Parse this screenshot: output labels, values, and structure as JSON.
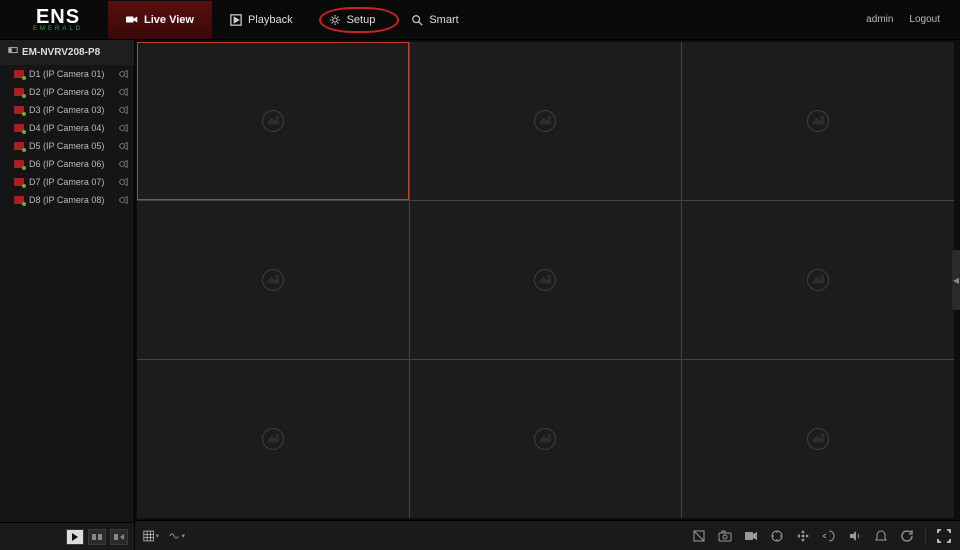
{
  "brand": {
    "name": "ENS",
    "sub": "EMERALD"
  },
  "nav": {
    "live": "Live View",
    "playback": "Playback",
    "setup": "Setup",
    "smart": "Smart"
  },
  "user": {
    "name": "admin",
    "logout": "Logout"
  },
  "device": {
    "name": "EM-NVRV208-P8"
  },
  "channels": [
    {
      "label": "D1 (IP Camera 01)"
    },
    {
      "label": "D2 (IP Camera 02)"
    },
    {
      "label": "D3 (IP Camera 03)"
    },
    {
      "label": "D4 (IP Camera 04)"
    },
    {
      "label": "D5 (IP Camera 05)"
    },
    {
      "label": "D6 (IP Camera 06)"
    },
    {
      "label": "D7 (IP Camera 07)"
    },
    {
      "label": "D8 (IP Camera 08)"
    }
  ],
  "grid": {
    "cols": 3,
    "rows": 3,
    "selected": 0
  }
}
